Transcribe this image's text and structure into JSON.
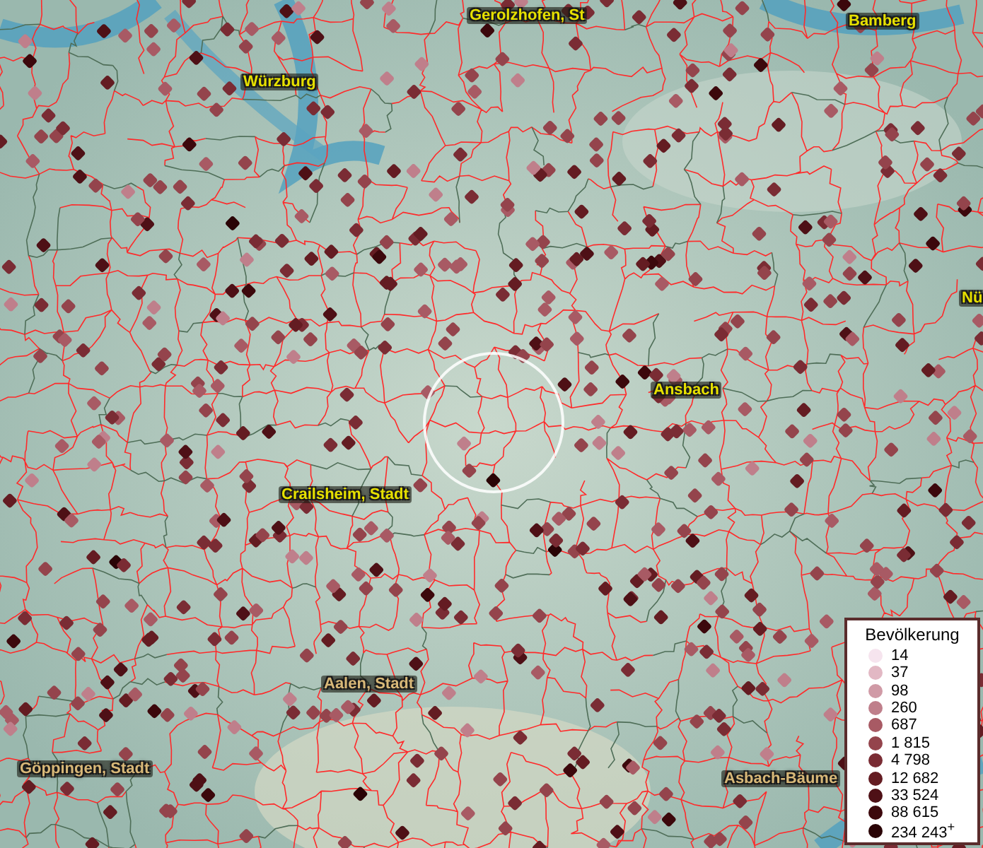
{
  "map": {
    "places": [
      {
        "name": "Gerolzhofen, St",
        "kind": "primary"
      },
      {
        "name": "Bamberg",
        "kind": "primary"
      },
      {
        "name": "Würzburg",
        "kind": "primary"
      },
      {
        "name": "Nü",
        "kind": "primary"
      },
      {
        "name": "Ansbach",
        "kind": "primary"
      },
      {
        "name": "Crailsheim, Stadt",
        "kind": "primary"
      },
      {
        "name": "Aalen, Stadt",
        "kind": "secondary"
      },
      {
        "name": "Göppingen, Stadt",
        "kind": "secondary"
      },
      {
        "name": "Asbach-Bäume",
        "kind": "secondary"
      }
    ]
  },
  "legend": {
    "title": "Bevölkerung",
    "entries": [
      {
        "label": "14",
        "color": "#f6e4ee"
      },
      {
        "label": "37",
        "color": "#e2b8c4"
      },
      {
        "label": "98",
        "color": "#d09aa6"
      },
      {
        "label": "260",
        "color": "#bf7f8b"
      },
      {
        "label": "687",
        "color": "#a85a64"
      },
      {
        "label": "1 815",
        "color": "#94444c"
      },
      {
        "label": "4 798",
        "color": "#7a2c34"
      },
      {
        "label": "12 682",
        "color": "#641c22"
      },
      {
        "label": "33 524",
        "color": "#4e1016"
      },
      {
        "label": "88 615",
        "color": "#3c080c"
      },
      {
        "label": "234 243$^{+}$",
        "color": "#2a0406"
      }
    ]
  }
}
